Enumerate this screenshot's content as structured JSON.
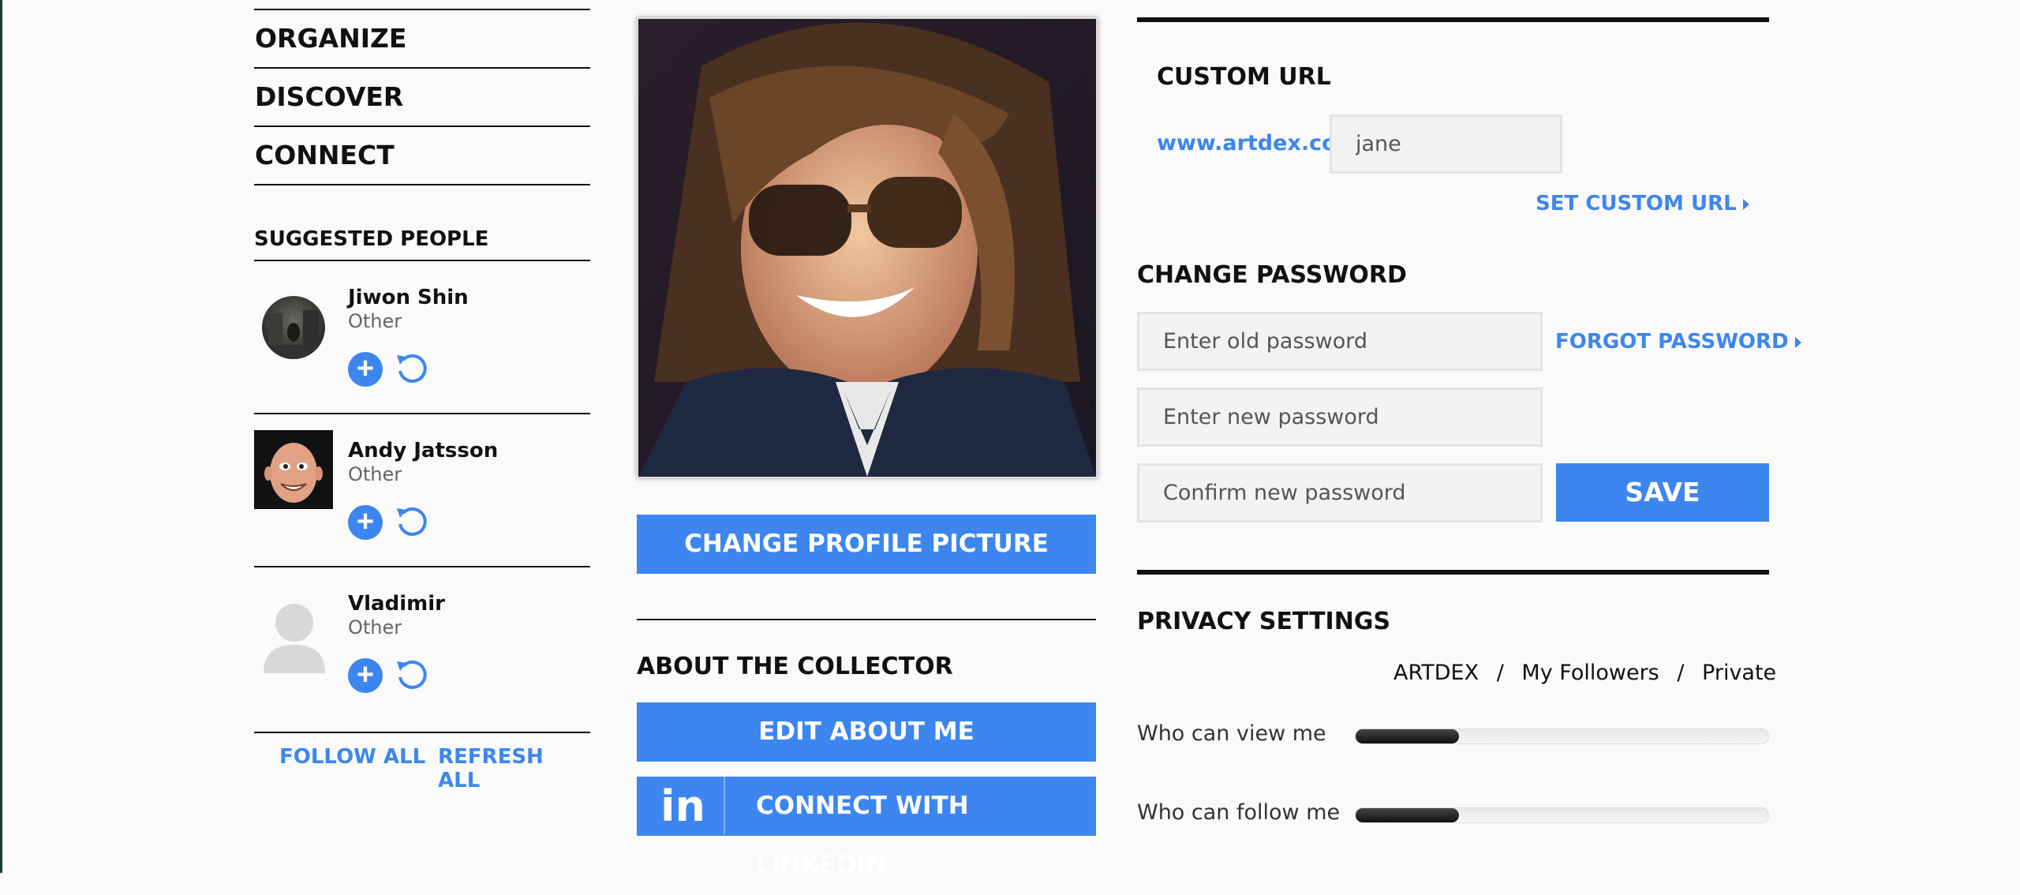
{
  "nav": {
    "items": [
      {
        "label": "ORGANIZE"
      },
      {
        "label": "DISCOVER"
      },
      {
        "label": "CONNECT"
      }
    ]
  },
  "suggested": {
    "title": "SUGGESTED PEOPLE",
    "people": [
      {
        "name": "Jiwon Shin",
        "role": "Other"
      },
      {
        "name": "Andy Jatsson",
        "role": "Other"
      },
      {
        "name": "Vladimir",
        "role": "Other"
      }
    ],
    "follow_all": "FOLLOW ALL",
    "refresh_all": "REFRESH ALL"
  },
  "profile": {
    "change_picture": "CHANGE PROFILE PICTURE",
    "about_title": "ABOUT THE COLLECTOR",
    "edit_about": "EDIT ABOUT ME",
    "linkedin_icon_text": "in",
    "connect_linkedin": "CONNECT WITH LINKEDIN"
  },
  "custom_url": {
    "title": "CUSTOM URL",
    "prefix": "www.artdex.com/",
    "value": "jane",
    "set_link": "SET CUSTOM URL"
  },
  "password": {
    "title": "CHANGE PASSWORD",
    "old_placeholder": "Enter old password",
    "new_placeholder": "Enter new password",
    "confirm_placeholder": "Confirm new password",
    "forgot_link": "FORGOT PASSWORD",
    "save": "SAVE"
  },
  "privacy": {
    "title": "PRIVACY SETTINGS",
    "levels": [
      "ARTDEX",
      "My Followers",
      "Private"
    ],
    "separator": "/",
    "settings": [
      {
        "label": "Who can view me",
        "level": 0.25
      },
      {
        "label": "Who can follow me",
        "level": 0.25
      }
    ]
  },
  "colors": {
    "accent": "#3d86f0",
    "text": "#111111",
    "background": "#fafafa"
  }
}
